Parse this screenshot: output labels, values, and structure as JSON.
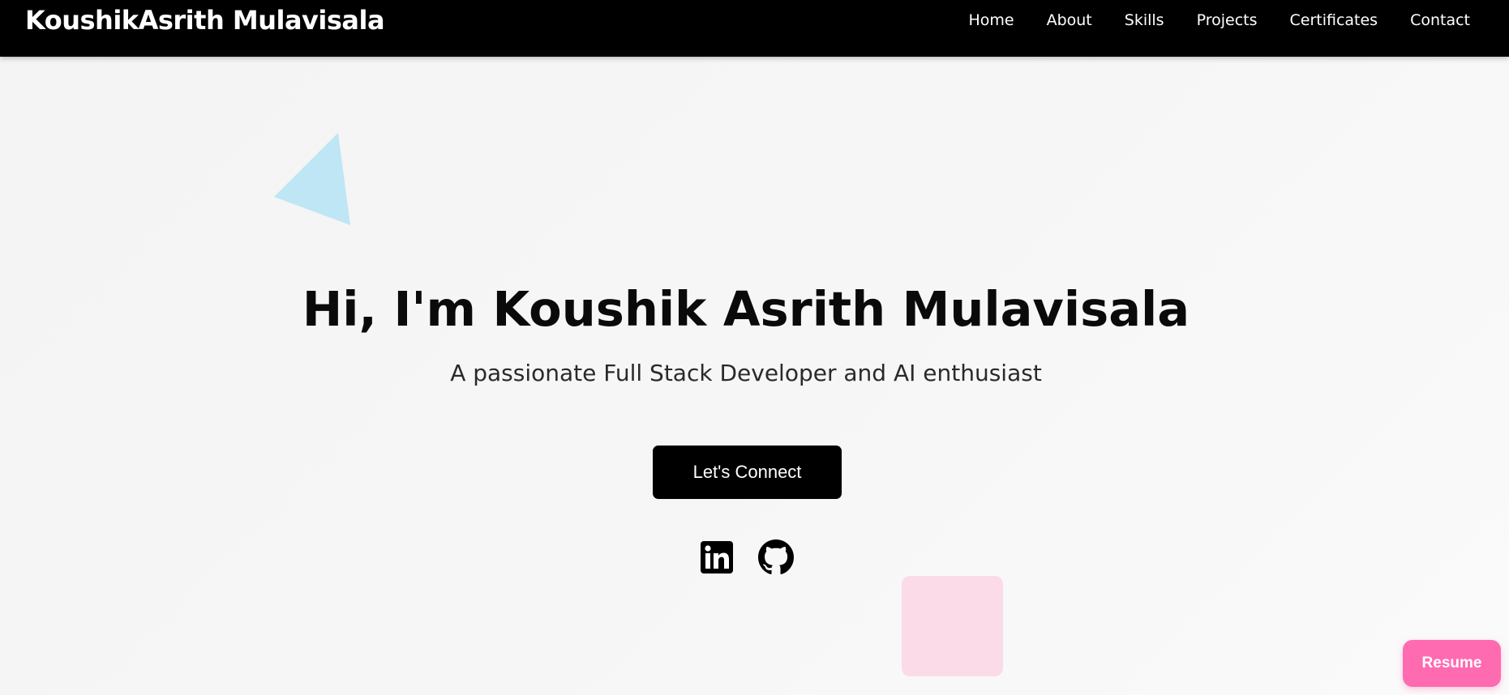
{
  "nav": {
    "brand": "KoushikAsrith Mulavisala",
    "links": [
      {
        "label": "Home"
      },
      {
        "label": "About"
      },
      {
        "label": "Skills"
      },
      {
        "label": "Projects"
      },
      {
        "label": "Certificates"
      },
      {
        "label": "Contact"
      }
    ]
  },
  "hero": {
    "title": "Hi, I'm Koushik Asrith Mulavisala",
    "subtitle": "A passionate Full Stack Developer and AI enthusiast",
    "cta_label": "Let's Connect"
  },
  "social": [
    {
      "icon": "linkedin-icon"
    },
    {
      "icon": "github-icon"
    }
  ],
  "floating": {
    "resume_label": "Resume"
  },
  "colors": {
    "navbar_bg": "#000000",
    "accent_pink": "#ff6bb0",
    "triangle": "#bfe6f5",
    "pink_square": "#fcdbe9"
  }
}
